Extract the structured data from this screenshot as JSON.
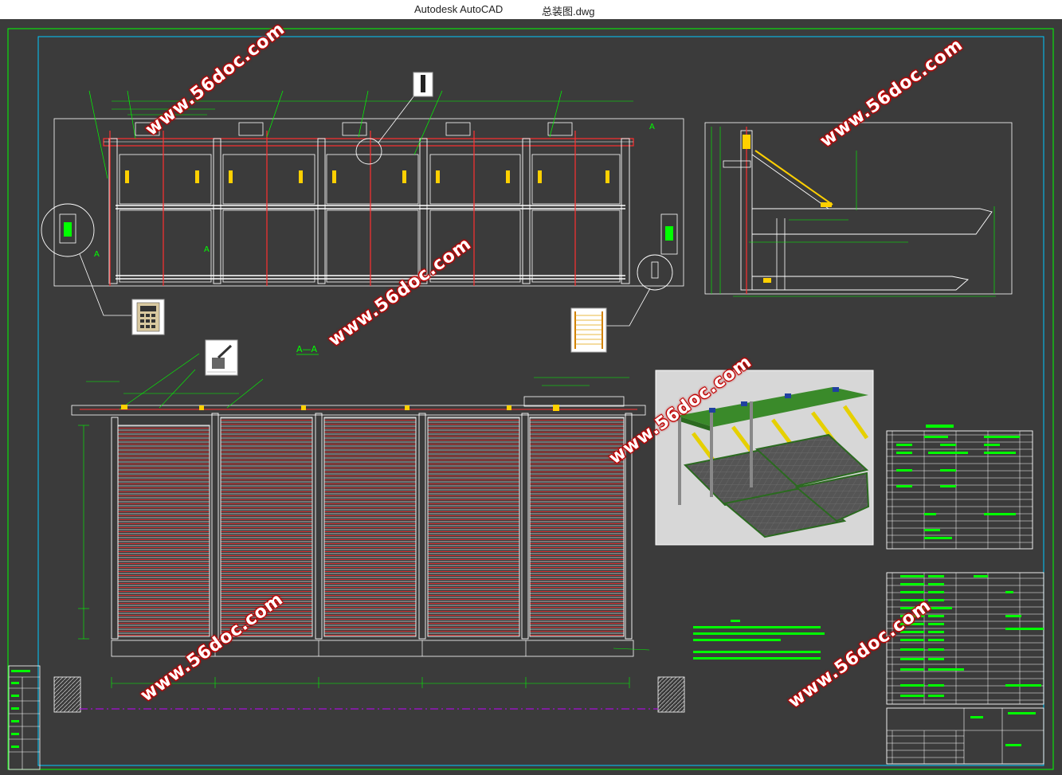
{
  "window": {
    "app_title": "Autodesk AutoCAD",
    "file_name": "总装图.dwg"
  },
  "watermark": {
    "text": "www.56doc.com"
  },
  "colors": {
    "background": "#3b3b3b",
    "frame": "#00c8ff",
    "dims": "#00ff00",
    "outline": "#ffffff",
    "hidden": "#ff3030",
    "watermark_text": "#ffffff",
    "watermark_outline": "#c00000"
  },
  "drawing": {
    "section_label": "A—A"
  }
}
